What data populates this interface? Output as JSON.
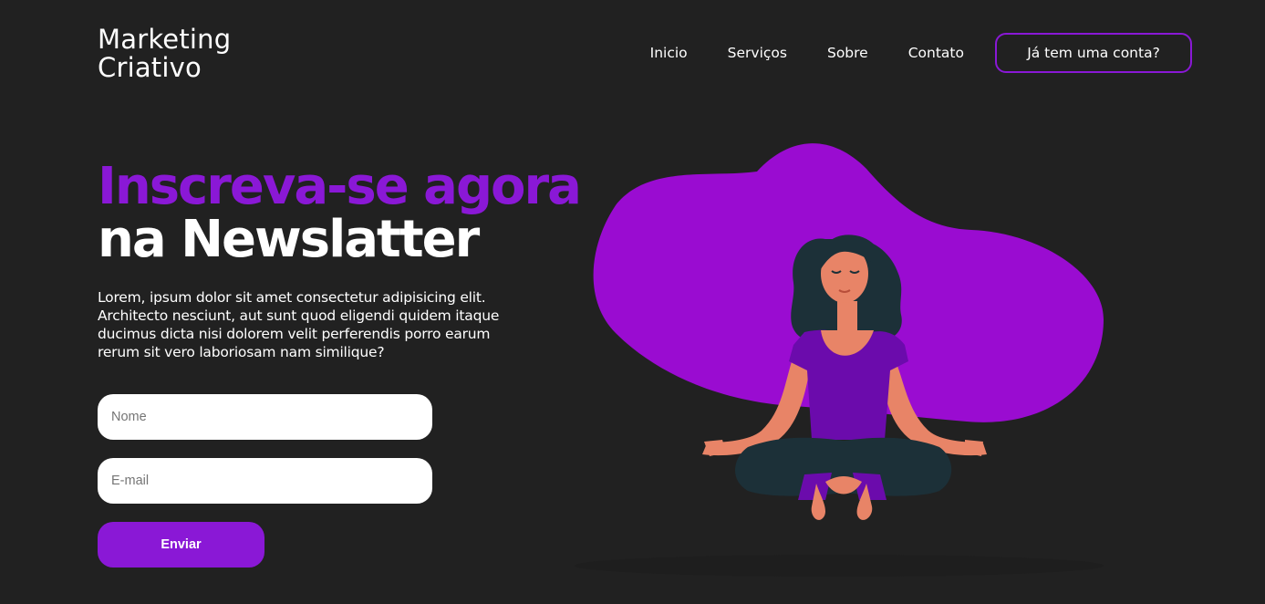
{
  "brand": {
    "line1": "Marketing",
    "line2": "Criativo"
  },
  "nav": {
    "items": [
      "Inicio",
      "Serviços",
      "Sobre",
      "Contato"
    ],
    "account_button": "Já tem uma conta?"
  },
  "hero": {
    "title_line1": "Inscreva-se agora",
    "title_line2": "na Newslatter",
    "description": "Lorem, ipsum dolor sit amet consectetur adipisicing elit. Architecto nesciunt, aut sunt quod eligendi quidem itaque ducimus dicta nisi dolorem velit perferendis porro earum rerum sit vero laboriosam nam similique?"
  },
  "form": {
    "name_placeholder": "Nome",
    "email_placeholder": "E-mail",
    "submit_label": "Enviar"
  },
  "colors": {
    "accent": "#8a18d6",
    "background": "#212121",
    "blob": "#9a0cd1",
    "skin": "#e88467",
    "hair": "#1c3038",
    "shirt": "#6b0bac"
  },
  "illustration": {
    "icon": "meditating-woman-illustration"
  }
}
